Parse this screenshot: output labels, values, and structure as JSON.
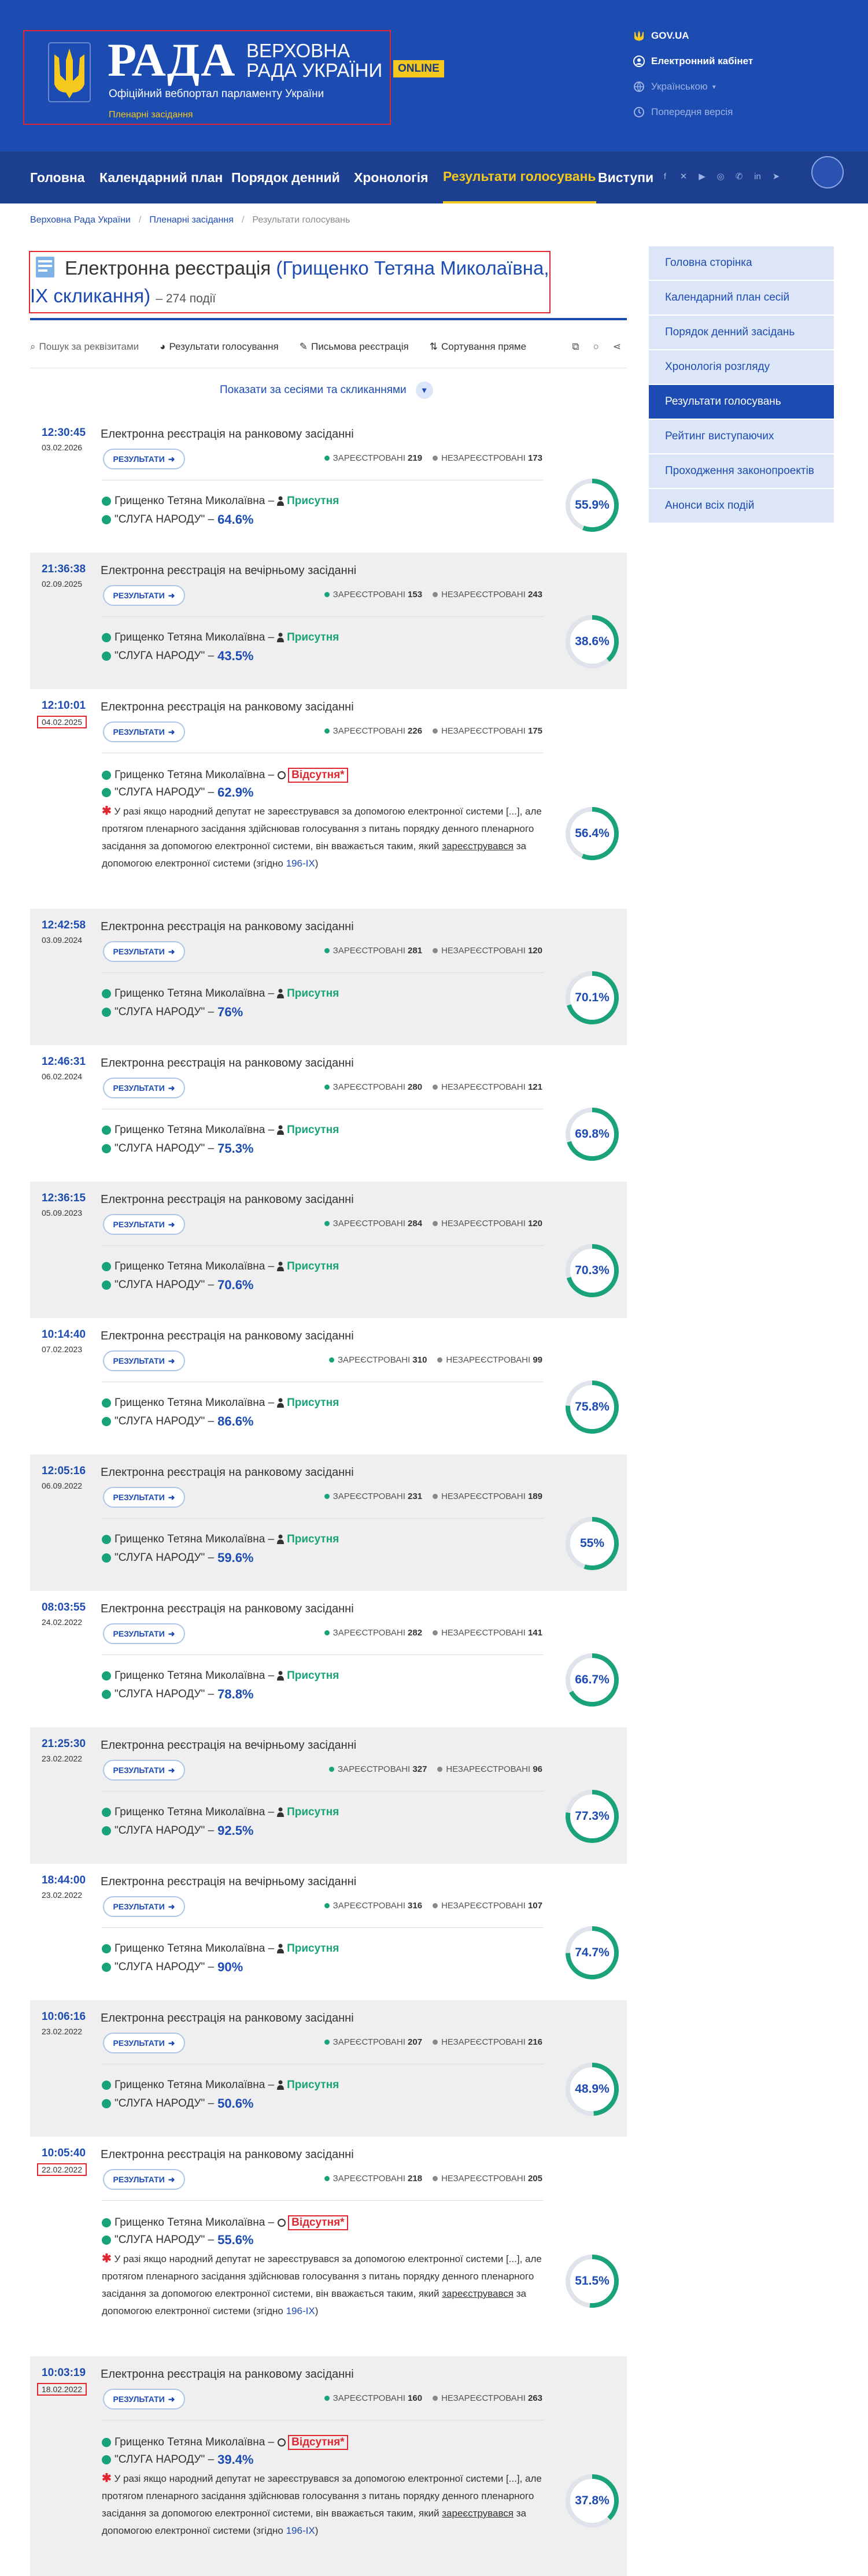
{
  "header": {
    "logo_main": "РАДА",
    "logo_line1": "ВЕРХОВНА",
    "logo_line2": "РАДА УКРАЇНИ",
    "logo_badge": "ONLINE",
    "logo_subtitle": "Офіційний вебпортал парламенту України",
    "logo_section": "Пленарні засідання",
    "links": [
      {
        "label": "GOV.UA",
        "icon": "trident-icon"
      },
      {
        "label": "Електронний кабінет",
        "icon": "user-icon"
      },
      {
        "label": "Українською",
        "icon": "globe-icon"
      },
      {
        "label": "Попередня версія",
        "icon": "history-icon"
      }
    ]
  },
  "nav": {
    "items": [
      "Головна",
      "Календарний план",
      "Порядок денний",
      "Хронологія",
      "Результати голосувань",
      "Виступи"
    ],
    "active": "Результати голосувань",
    "social": [
      "facebook-icon",
      "x-icon",
      "youtube-icon",
      "instagram-icon",
      "whatsapp-icon",
      "linkedin-icon",
      "telegram-icon"
    ]
  },
  "breadcrumb": [
    "Верховна Рада України",
    "Пленарні засідання",
    "Результати голосувань"
  ],
  "page": {
    "title": "Електронна реєстрація",
    "name": "(Грищенко Тетяна Миколаївна, IX скликання)",
    "count": "– 274 події"
  },
  "toolbar": {
    "search": "Пошук за реквізитами",
    "voting_results": "Результати голосування",
    "written": "Письмова реєстрація",
    "sort": "Сортування пряме"
  },
  "show_by": "Показати за сесіями та скликаннями",
  "sidebar": [
    "Головна сторінка",
    "Календарний план сесій",
    "Порядок денний засідань",
    "Хронологія розгляду",
    "Результати голосувань",
    "Рейтинг виступаючих",
    "Проходження законопроектів",
    "Анонси всіх подій"
  ],
  "sidebar_active": "Результати голосувань",
  "labels": {
    "results_btn": "РЕЗУЛЬТАТИ",
    "registered": "ЗАРЕЄСТРОВАНІ",
    "unregistered": "НЕЗАРЕЄСТРОВАНІ",
    "deputy": "Грищенко Тетяна Миколаївна –",
    "faction": "\"СЛУГА НАРОДУ\" –",
    "present": "Присутня",
    "absent": "Відсутня*",
    "note_part1": "У разі якщо народний депутат не зареєструвався за допомогою електронної системи [...], але протягом пленарного засідання здійснював голосування з питань порядку денного пленарного засідання за допомогою електронної системи, він вважається таким, який",
    "note_underlined": "зареєструвався",
    "note_part2": "за допомогою електронної системи (згідно",
    "note_link": "196-IX",
    "note_end": ")"
  },
  "colors": {
    "brand": "#1c4bb2",
    "accent": "#f4c81c",
    "success": "#1aa37a",
    "danger": "#e0262f"
  },
  "records": [
    {
      "time": "12:30:45",
      "date": "03.02.2026",
      "type": "Електронна реєстрація на ранковому засіданні",
      "registered": 219,
      "unregistered": 173,
      "status": "present",
      "faction_pct": "64.6%",
      "pct": "55.9%",
      "pct_value": 55.9,
      "shaded": false,
      "date_boxed": false
    },
    {
      "time": "21:36:38",
      "date": "02.09.2025",
      "type": "Електронна реєстрація на вечірньому засіданні",
      "registered": 153,
      "unregistered": 243,
      "status": "present",
      "faction_pct": "43.5%",
      "pct": "38.6%",
      "pct_value": 38.6,
      "shaded": true,
      "date_boxed": false
    },
    {
      "time": "12:10:01",
      "date": "04.02.2025",
      "type": "Електронна реєстрація на ранковому засіданні",
      "registered": 226,
      "unregistered": 175,
      "status": "absent",
      "faction_pct": "62.9%",
      "pct": "56.4%",
      "pct_value": 56.4,
      "shaded": false,
      "date_boxed": true
    },
    {
      "time": "12:42:58",
      "date": "03.09.2024",
      "type": "Електронна реєстрація на ранковому засіданні",
      "registered": 281,
      "unregistered": 120,
      "status": "present",
      "faction_pct": "76%",
      "pct": "70.1%",
      "pct_value": 70.1,
      "shaded": true,
      "date_boxed": false
    },
    {
      "time": "12:46:31",
      "date": "06.02.2024",
      "type": "Електронна реєстрація на ранковому засіданні",
      "registered": 280,
      "unregistered": 121,
      "status": "present",
      "faction_pct": "75.3%",
      "pct": "69.8%",
      "pct_value": 69.8,
      "shaded": false,
      "date_boxed": false
    },
    {
      "time": "12:36:15",
      "date": "05.09.2023",
      "type": "Електронна реєстрація на ранковому засіданні",
      "registered": 284,
      "unregistered": 120,
      "status": "present",
      "faction_pct": "70.6%",
      "pct": "70.3%",
      "pct_value": 70.3,
      "shaded": true,
      "date_boxed": false
    },
    {
      "time": "10:14:40",
      "date": "07.02.2023",
      "type": "Електронна реєстрація на ранковому засіданні",
      "registered": 310,
      "unregistered": 99,
      "status": "present",
      "faction_pct": "86.6%",
      "pct": "75.8%",
      "pct_value": 75.8,
      "shaded": false,
      "date_boxed": false
    },
    {
      "time": "12:05:16",
      "date": "06.09.2022",
      "type": "Електронна реєстрація на ранковому засіданні",
      "registered": 231,
      "unregistered": 189,
      "status": "present",
      "faction_pct": "59.6%",
      "pct": "55%",
      "pct_value": 55,
      "shaded": true,
      "date_boxed": false
    },
    {
      "time": "08:03:55",
      "date": "24.02.2022",
      "type": "Електронна реєстрація на ранковому засіданні",
      "registered": 282,
      "unregistered": 141,
      "status": "present",
      "faction_pct": "78.8%",
      "pct": "66.7%",
      "pct_value": 66.7,
      "shaded": false,
      "date_boxed": false
    },
    {
      "time": "21:25:30",
      "date": "23.02.2022",
      "type": "Електронна реєстрація на вечірньому засіданні",
      "registered": 327,
      "unregistered": 96,
      "status": "present",
      "faction_pct": "92.5%",
      "pct": "77.3%",
      "pct_value": 77.3,
      "shaded": true,
      "date_boxed": false
    },
    {
      "time": "18:44:00",
      "date": "23.02.2022",
      "type": "Електронна реєстрація на вечірньому засіданні",
      "registered": 316,
      "unregistered": 107,
      "status": "present",
      "faction_pct": "90%",
      "pct": "74.7%",
      "pct_value": 74.7,
      "shaded": false,
      "date_boxed": false
    },
    {
      "time": "10:06:16",
      "date": "23.02.2022",
      "type": "Електронна реєстрація на ранковому засіданні",
      "registered": 207,
      "unregistered": 216,
      "status": "present",
      "faction_pct": "50.6%",
      "pct": "48.9%",
      "pct_value": 48.9,
      "shaded": true,
      "date_boxed": false
    },
    {
      "time": "10:05:40",
      "date": "22.02.2022",
      "type": "Електронна реєстрація на ранковому засіданні",
      "registered": 218,
      "unregistered": 205,
      "status": "absent",
      "faction_pct": "55.6%",
      "pct": "51.5%",
      "pct_value": 51.5,
      "shaded": false,
      "date_boxed": true
    },
    {
      "time": "10:03:19",
      "date": "18.02.2022",
      "type": "Електронна реєстрація на ранковому засіданні",
      "registered": 160,
      "unregistered": 263,
      "status": "absent",
      "faction_pct": "39.4%",
      "pct": "37.8%",
      "pct_value": 37.8,
      "shaded": true,
      "date_boxed": true
    }
  ]
}
